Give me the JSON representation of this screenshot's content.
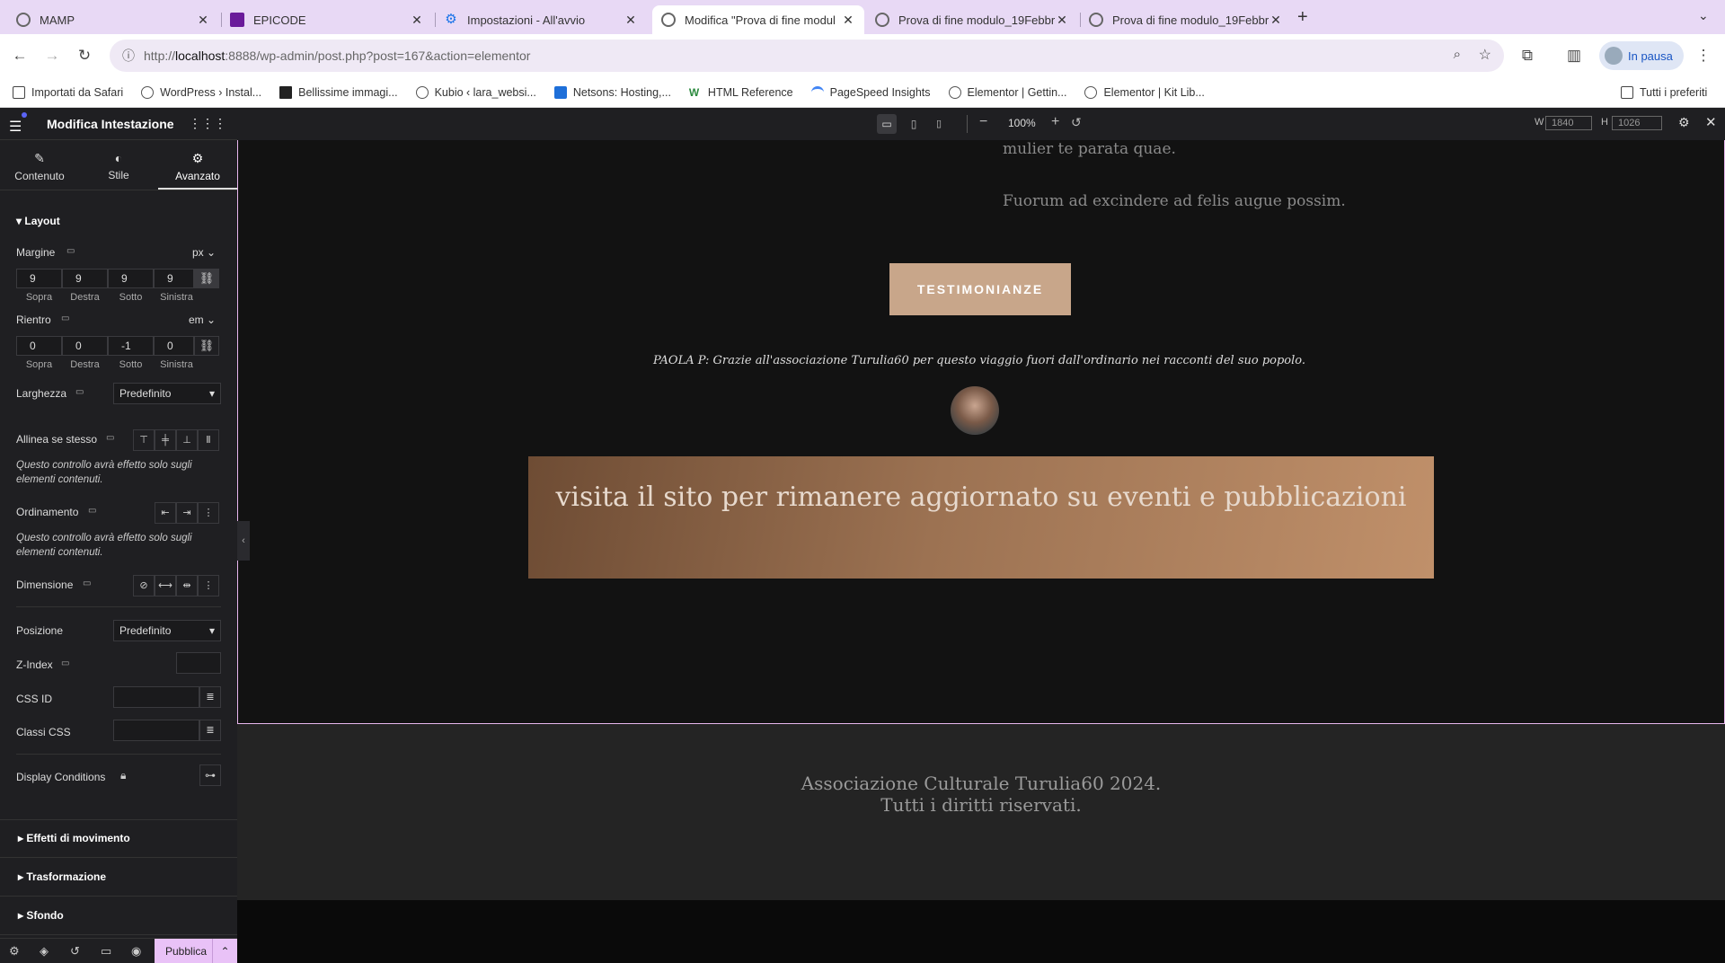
{
  "browser": {
    "tabs": [
      {
        "title": "MAMP",
        "favicon_color": "#777777"
      },
      {
        "title": "EPICODE",
        "favicon_color": "#6a1b9a"
      },
      {
        "title": "Impostazioni - All'avvio",
        "favicon_color": "#1a73e8"
      },
      {
        "title": "Modifica \"Prova di fine modul",
        "favicon_color": "#555555"
      },
      {
        "title": "Prova di fine modulo_19Febbr",
        "favicon_color": "#555555"
      },
      {
        "title": "Prova di fine modulo_19Febbr",
        "favicon_color": "#555555"
      }
    ],
    "url_prefix": "http://",
    "url_host": "localhost",
    "url_rest": ":8888/wp-admin/post.php?post=167&action=elementor",
    "profile_label": "In pausa",
    "bookmarks": [
      "Importati da Safari",
      "WordPress › Instal...",
      "Bellissime immagi...",
      "Kubio ‹ lara_websi...",
      "Netsons: Hosting,...",
      "HTML Reference",
      "PageSpeed Insights",
      "Elementor | Gettin...",
      "Elementor | Kit Lib..."
    ],
    "all_bookmarks": "Tutti i preferiti"
  },
  "topbar": {
    "zoom": "100%",
    "width_label": "W",
    "width_value": "1840",
    "height_label": "H",
    "height_value": "1026"
  },
  "panel": {
    "title": "Modifica Intestazione",
    "tabs": [
      "Contenuto",
      "Stile",
      "Avanzato"
    ],
    "layout_title": "Layout",
    "margin": {
      "label": "Margine",
      "unit": "px",
      "values": [
        "9",
        "9",
        "9",
        "9"
      ],
      "sides": [
        "Sopra",
        "Destra",
        "Sotto",
        "Sinistra"
      ]
    },
    "padding": {
      "label": "Rientro",
      "unit": "em",
      "values": [
        "0",
        "0",
        "-1",
        "0"
      ],
      "sides": [
        "Sopra",
        "Destra",
        "Sotto",
        "Sinistra"
      ]
    },
    "width": {
      "label": "Larghezza",
      "value": "Predefinito"
    },
    "align_self": {
      "label": "Allinea se stesso",
      "note": "Questo controllo avrà effetto solo sugli elementi contenuti."
    },
    "order": {
      "label": "Ordinamento",
      "note": "Questo controllo avrà effetto solo sugli elementi contenuti."
    },
    "size": {
      "label": "Dimensione"
    },
    "position": {
      "label": "Posizione",
      "value": "Predefinito"
    },
    "zindex": {
      "label": "Z-Index"
    },
    "css_id": {
      "label": "CSS ID"
    },
    "css_classes": {
      "label": "Classi CSS"
    },
    "display_conditions": {
      "label": "Display Conditions"
    },
    "sections": [
      "Effetti di movimento",
      "Trasformazione",
      "Sfondo"
    ],
    "publish": "Pubblica"
  },
  "page": {
    "text_line1": "mulier te parata quae.",
    "text_line2": "Fuorum ad excindere ad felis augue possim.",
    "button": "TESTIMONIANZE",
    "testimonial": "PAOLA P: Grazie all'associazione Turulia60 per questo viaggio fuori dall'ordinario nei racconti del suo popolo.",
    "banner_text": "visita il sito per rimanere aggiornato su eventi e pubblicazioni",
    "footer_line1": "Associazione Culturale Turulia60 2024.",
    "footer_line2": "Tutti i diritti riservati."
  },
  "colors": {
    "tabbar": "#e8d9f5",
    "panel_bg": "#1f1f22",
    "button_bg": "#c8a68a",
    "publish_bg": "#e9c2f7",
    "frame_border": "#e8b7ee"
  }
}
